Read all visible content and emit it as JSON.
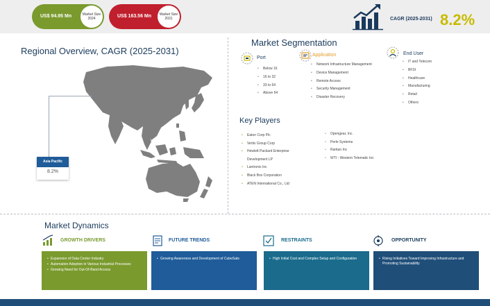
{
  "header": {
    "market_2024": {
      "value": "US$ 94.95 Mn",
      "label_line1": "Market Size",
      "label_line2": "2024"
    },
    "market_2031": {
      "value": "US$ 163.56 Mn",
      "label_line1": "Market Size",
      "label_line2": "2031"
    },
    "cagr_label": "CAGR (2025-2031)",
    "cagr_value": "8.2%"
  },
  "regional": {
    "title": "Regional Overview, CAGR (2025-2031)",
    "region_name": "Asia Pacific",
    "region_cagr": "8.2%"
  },
  "segmentation": {
    "title": "Market Segmentation",
    "port": {
      "heading": "Port",
      "items": [
        "Below 16",
        "16 to 32",
        "33 to 64",
        "Above 64"
      ]
    },
    "application": {
      "heading": "Application",
      "items": [
        "Network Infrastructure Management",
        "Device Management",
        "Remote Access",
        "Security Management",
        "Disaster Recovery"
      ]
    },
    "end_user": {
      "heading": "End User",
      "items": [
        "IT and Telecom",
        "BFSI",
        "Healthcare",
        "Manufacturing",
        "Retail",
        "Others"
      ]
    }
  },
  "key_players": {
    "title": "Key Players",
    "col1": [
      "Eaton Corp Plc",
      "Vertiv Group Corp",
      "Hewlett Packard Enterprise",
      "Development LP",
      "Lantronix Inc",
      "Black Box Corporation",
      "ATEN International Co., Ltd"
    ],
    "col2": [
      "Opengear, Inc.",
      "Perle Systems",
      "Raritan Inc",
      "WTI - Western Telematic Inc"
    ]
  },
  "dynamics": {
    "title": "Market Dynamics",
    "growth_drivers": {
      "heading": "GROWTH DRIVERS",
      "items": [
        "Expansion of Data Center Industry",
        "Automation Adoption in Various Industrial Processes",
        "Growing Need for Out-Of-Band Access"
      ]
    },
    "future_trends": {
      "heading": "FUTURE TRENDS",
      "items": [
        "Growing Awareness and Development of CubeSats"
      ]
    },
    "restraints": {
      "heading": "RESTRAINTS",
      "items": [
        "High Initial Cost and Complex Setup and Configuration"
      ]
    },
    "opportunity": {
      "heading": "OPPORTUNITY",
      "items": [
        "Rising Initiatives Toward Improving Infrastructure and Promoting Sustainability"
      ]
    }
  },
  "colors": {
    "green": "#7a9a2e",
    "red": "#c0202e",
    "navy": "#1a3a5c",
    "blue": "#1f5c99",
    "teal": "#1a6b8c",
    "gold": "#c8bb00",
    "orange": "#e39a27"
  }
}
